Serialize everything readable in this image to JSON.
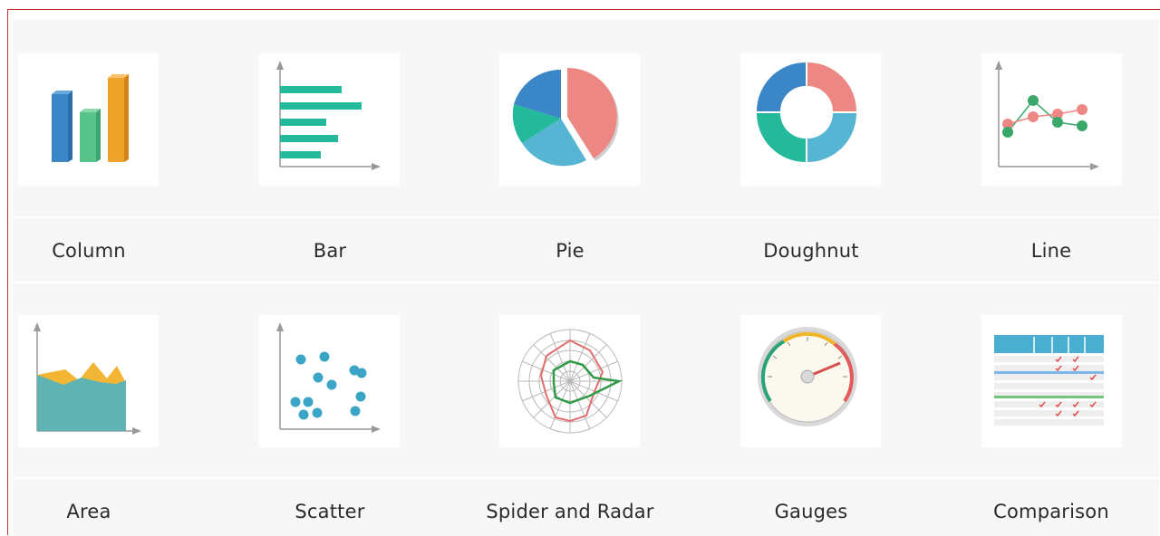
{
  "gallery": {
    "items": [
      {
        "label": "Column",
        "icon": "column-chart-icon"
      },
      {
        "label": "Bar",
        "icon": "bar-chart-icon"
      },
      {
        "label": "Pie",
        "icon": "pie-chart-icon"
      },
      {
        "label": "Doughnut",
        "icon": "doughnut-chart-icon"
      },
      {
        "label": "Line",
        "icon": "line-chart-icon"
      },
      {
        "label": "Area",
        "icon": "area-chart-icon"
      },
      {
        "label": "Scatter",
        "icon": "scatter-chart-icon"
      },
      {
        "label": "Spider and Radar",
        "icon": "radar-chart-icon"
      },
      {
        "label": "Gauges",
        "icon": "gauge-icon"
      },
      {
        "label": "Comparison",
        "icon": "comparison-table-icon"
      }
    ]
  },
  "colors": {
    "blue": "#3b86c6",
    "green": "#58c38a",
    "orange": "#f0a32a",
    "teal": "#23b99a",
    "salmon": "#ec8784",
    "lightblue": "#56b5d3",
    "background": "#f7f7f8"
  }
}
